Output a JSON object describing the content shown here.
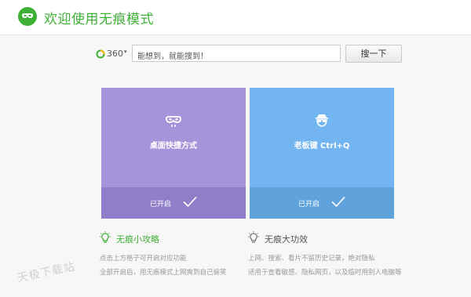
{
  "header": {
    "title": "欢迎使用无痕模式",
    "logo_icon": "mask-logo-icon",
    "accent_color": "#3eb035"
  },
  "search": {
    "engine_label": "360",
    "engine_caret": "▾",
    "input_text": "能想到，就能搜到！",
    "button_label": "搜一下"
  },
  "cards": [
    {
      "icon": "mask-icon",
      "title": "桌面快捷方式",
      "status": "已开启",
      "color": "#a594d9"
    },
    {
      "icon": "boss-key-icon",
      "title": "老板键 Ctrl+Q",
      "status": "已开启",
      "color": "#72b5f0"
    }
  ],
  "tips": {
    "left": {
      "icon": "lightbulb-icon",
      "heading": "无痕小攻略",
      "lines": [
        "点击上方格子可开启对应功能",
        "全部开启后，用无痕模式上网爽到自己偷笑"
      ]
    },
    "right": {
      "icon": "lightbulb-icon",
      "heading": "无痕大功效",
      "lines": [
        "上网、搜索、看片不留历史记录，绝对隐私",
        "适用于查看敏感、隐私网页，以及临时用别人电脑等"
      ]
    }
  },
  "watermark": "天极下载站"
}
